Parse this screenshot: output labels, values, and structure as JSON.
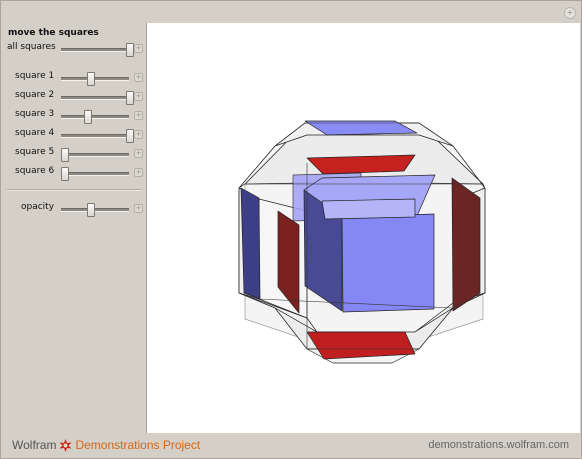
{
  "window": {
    "close_glyph": "+"
  },
  "controls": {
    "title": "move the squares",
    "sliders": [
      {
        "label": "all squares",
        "value": 1.0
      },
      {
        "label": "square 1",
        "value": 0.42
      },
      {
        "label": "square 2",
        "value": 1.0
      },
      {
        "label": "square 3",
        "value": 0.38
      },
      {
        "label": "square 4",
        "value": 1.0
      },
      {
        "label": "square 5",
        "value": 0.05
      },
      {
        "label": "square 6",
        "value": 0.05
      },
      {
        "label": "opacity",
        "value": 0.42
      }
    ],
    "plus_glyph": "+"
  },
  "footer": {
    "brand_prefix": "Wolfram",
    "brand_suffix": "Demonstrations Project",
    "url": "demonstrations.wolfram.com"
  },
  "colors": {
    "panel_bg": "#d4d0c8",
    "blue_face": "#8a8cf5",
    "red_face": "#bf1f1f",
    "brand_orange": "#d3671a"
  }
}
